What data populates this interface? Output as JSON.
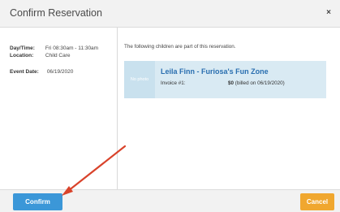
{
  "dialog": {
    "title": "Confirm Reservation",
    "close_glyph": "×"
  },
  "details": {
    "datetime_label": "Day/Time:",
    "datetime_value": "Fri 08:30am - 11:30am",
    "location_label": "Location:",
    "location_value": "Child Care",
    "event_date_label": "Event Date:",
    "event_date_value": "06/19/2020"
  },
  "children": {
    "intro": "The following children are part of this reservation.",
    "items": [
      {
        "photo_text": "No photo",
        "name": "Leila Finn - Furiosa's Fun Zone",
        "invoice_label": "Invoice #1:",
        "amount": "$0",
        "billed_note": "(billed on 06/19/2020)"
      }
    ]
  },
  "footer": {
    "confirm_label": "Confirm",
    "cancel_label": "Cancel"
  },
  "colors": {
    "confirm": "#3b97d8",
    "cancel": "#f0a72f",
    "child_name": "#2a6fb0",
    "card_bg": "#d9eaf3",
    "annotation_arrow": "#d9432b"
  }
}
